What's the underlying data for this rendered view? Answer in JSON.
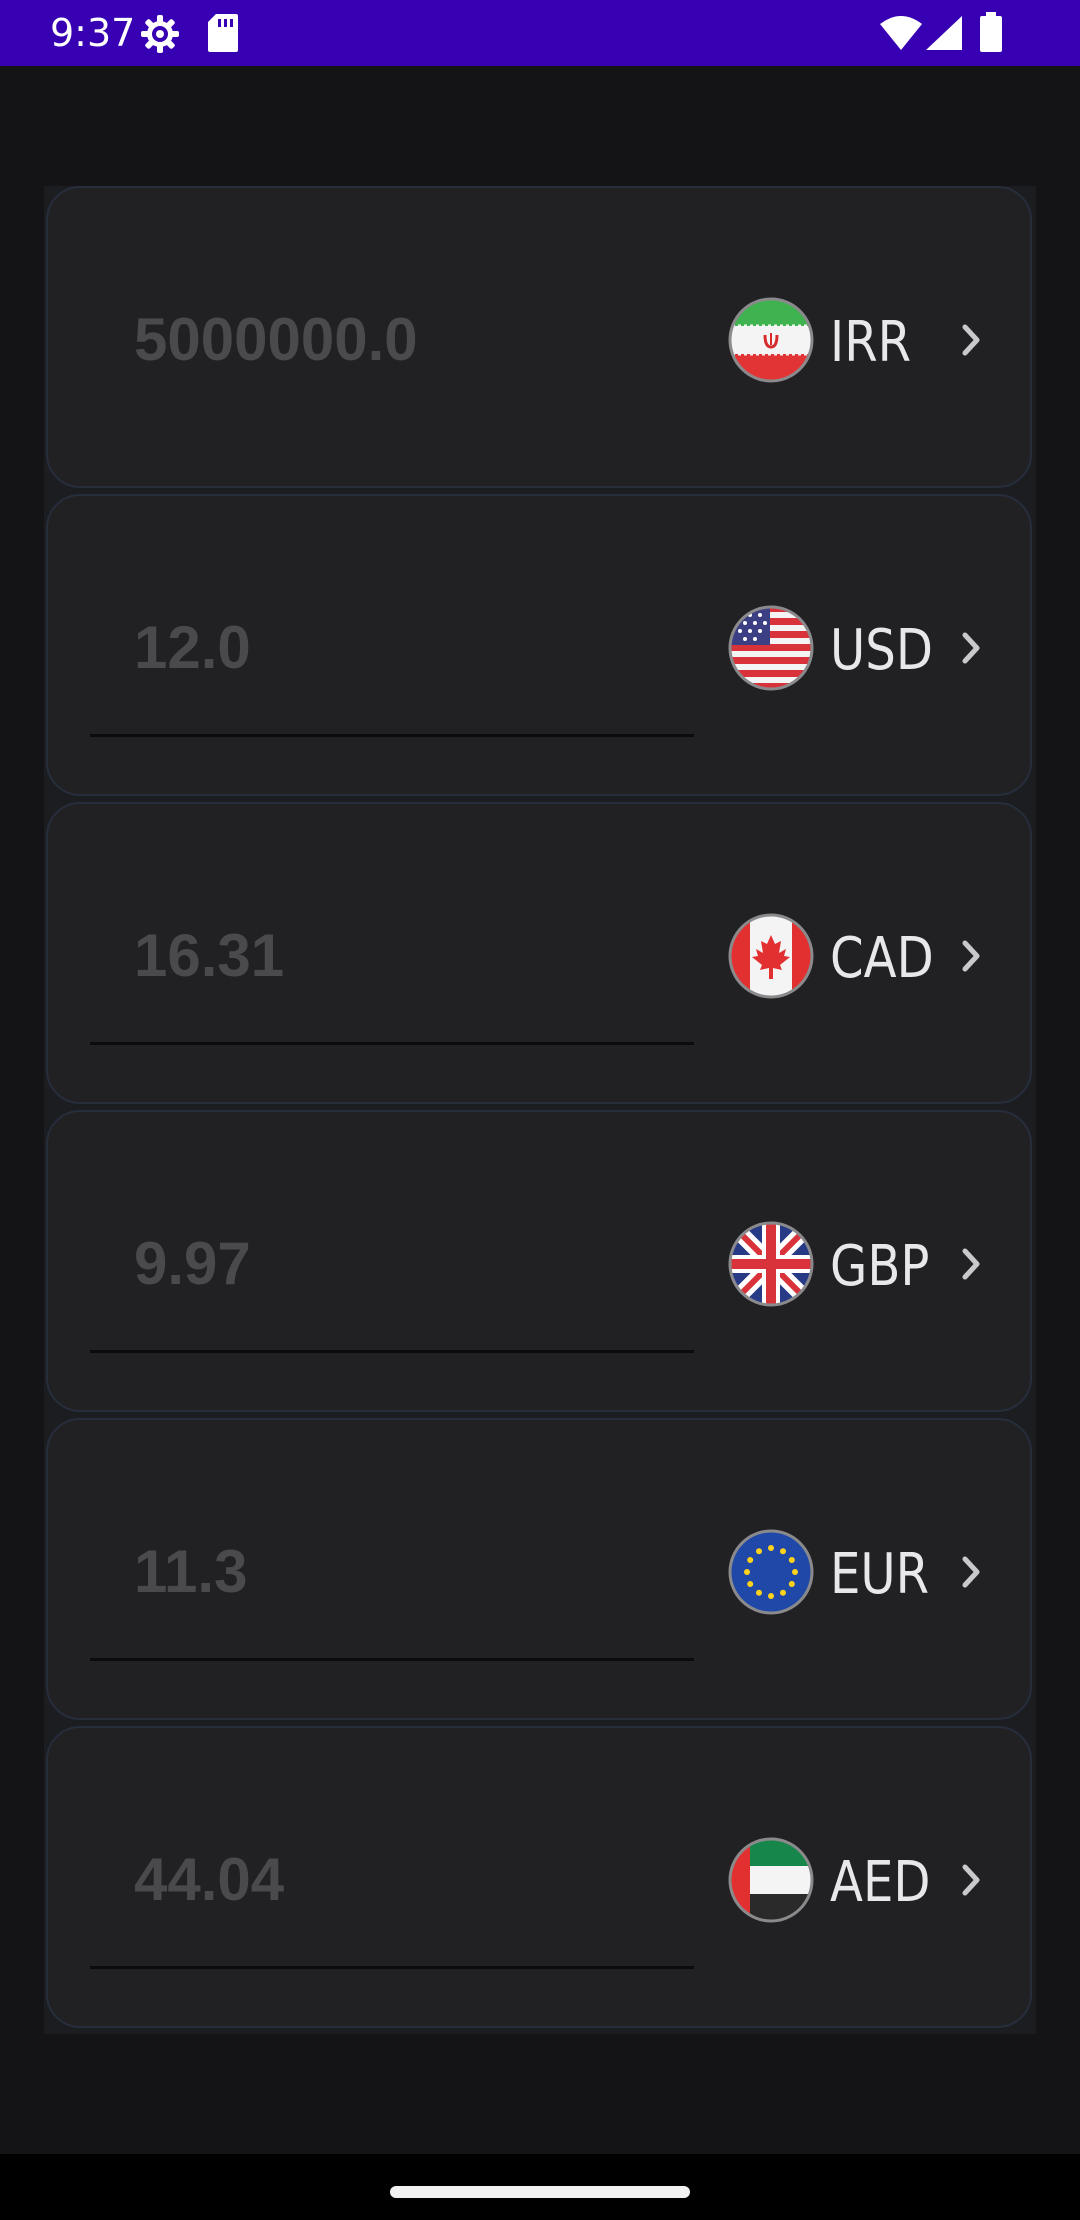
{
  "status_bar": {
    "time": "9:37",
    "icons": [
      "settings-gear-icon",
      "sd-card-icon",
      "wifi-icon",
      "cell-signal-icon",
      "battery-icon"
    ]
  },
  "colors": {
    "status_bar": "#3700b3",
    "background": "#141416",
    "card": "#212124",
    "card_border": "#262d3b",
    "amount_text": "#4a4a4d",
    "code_text": "#e8e8ea"
  },
  "currencies": [
    {
      "amount": "5000000.0",
      "code": "IRR",
      "flag_icon": "iran-flag-icon"
    },
    {
      "amount": "12.0",
      "code": "USD",
      "flag_icon": "usa-flag-icon"
    },
    {
      "amount": "16.31",
      "code": "CAD",
      "flag_icon": "canada-flag-icon"
    },
    {
      "amount": "9.97",
      "code": "GBP",
      "flag_icon": "uk-flag-icon"
    },
    {
      "amount": "11.3",
      "code": "EUR",
      "flag_icon": "eu-flag-icon"
    },
    {
      "amount": "44.04",
      "code": "AED",
      "flag_icon": "uae-flag-icon"
    }
  ]
}
